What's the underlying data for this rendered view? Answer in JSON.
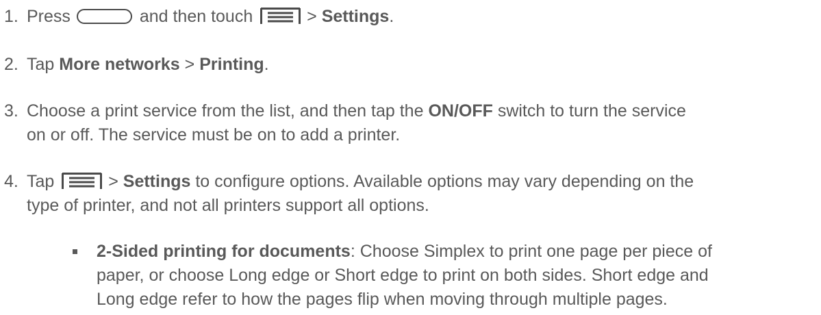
{
  "steps": [
    {
      "number": "1.",
      "press": "Press",
      "and_then_touch": "and then touch",
      "gt": ">",
      "settings": "Settings",
      "period": "."
    },
    {
      "number": "2.",
      "tap": "Tap",
      "more_networks": "More networks",
      "gt": ">",
      "printing": "Printing",
      "period": "."
    },
    {
      "number": "3.",
      "before": "Choose a print service from the list, and then tap the",
      "onoff": "ON/OFF",
      "after_line1": "switch to turn the service",
      "line2": "on or off. The service must be on to add a printer."
    },
    {
      "number": "4.",
      "tap": "Tap",
      "gt": ">",
      "settings": "Settings",
      "after_line1": "to configure options. Available options may vary depending on the",
      "line2": "type of printer, and not all printers support all options."
    }
  ],
  "bullet": {
    "term": "2-Sided printing for documents",
    "line1": ": Choose Simplex to print one page per piece of",
    "line2": "paper, or choose Long edge or Short edge to print on both sides. Short edge and",
    "line3": "Long edge refer to how the pages flip when moving through multiple pages."
  },
  "icons": {
    "home_key": "home-key-icon",
    "menu_key": "menu-key-icon"
  },
  "colors": {
    "text": "#595959",
    "icon": "#4a4a4a"
  }
}
